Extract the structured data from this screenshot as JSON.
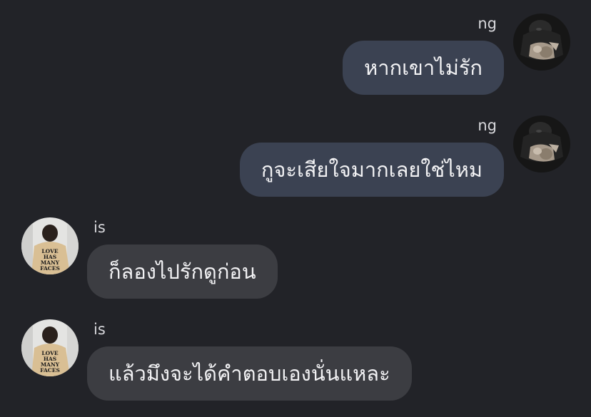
{
  "messages": [
    {
      "sender": "ng",
      "text": "หากเขาไม่รัก",
      "direction": "outgoing"
    },
    {
      "sender": "ng",
      "text": "กูจะเสียใจมากเลยใช่ไหม",
      "direction": "outgoing"
    },
    {
      "sender": "is",
      "text": "ก็ลองไปรักดูก่อน",
      "direction": "incoming"
    },
    {
      "sender": "is",
      "text": "แล้วมึงจะได้คำตอบเองนั่นแหละ",
      "direction": "incoming"
    }
  ],
  "avatars": {
    "is_shirt_text": [
      "LOVE",
      "HAS",
      "MANY",
      "FACES"
    ]
  },
  "colors": {
    "background": "#222328",
    "outgoing_bubble": "#3b4252",
    "incoming_bubble": "#3c3d42",
    "text": "#f2f2f4"
  }
}
